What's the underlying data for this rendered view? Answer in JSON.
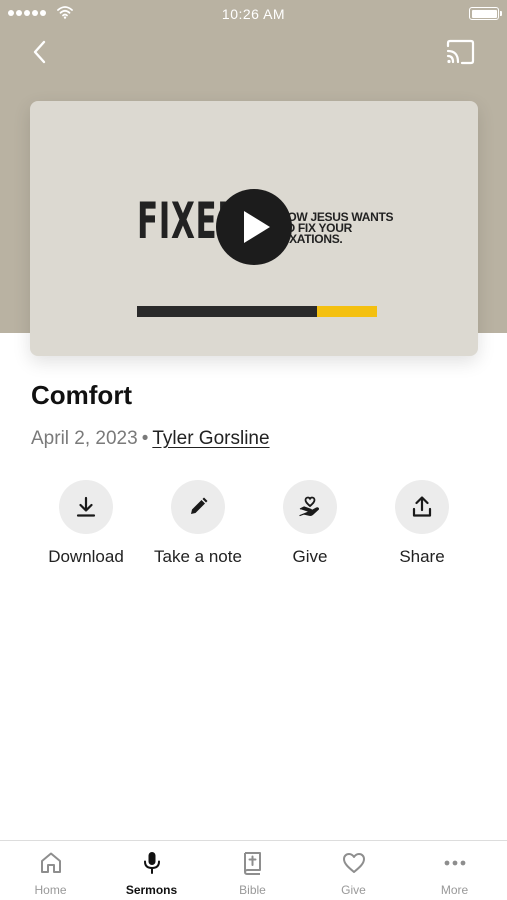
{
  "status_bar": {
    "time": "10:26 AM"
  },
  "video": {
    "series_title": "FIXED",
    "tagline": "HOW JESUS WANTS TO FIX YOUR FIXATIONS.",
    "progress": 0.25,
    "progress_color": "#f4c010"
  },
  "sermon": {
    "title": "Comfort",
    "date": "April 2, 2023",
    "separator": "•",
    "speaker": "Tyler Gorsline"
  },
  "actions": [
    {
      "label": "Download",
      "icon": "download-icon"
    },
    {
      "label": "Take a note",
      "icon": "pencil-icon"
    },
    {
      "label": "Give",
      "icon": "hand-heart-icon"
    },
    {
      "label": "Share",
      "icon": "share-icon"
    }
  ],
  "tabs": [
    {
      "label": "Home",
      "icon": "home-icon",
      "active": false
    },
    {
      "label": "Sermons",
      "icon": "microphone-icon",
      "active": true
    },
    {
      "label": "Bible",
      "icon": "bible-icon",
      "active": false
    },
    {
      "label": "Give",
      "icon": "heart-icon",
      "active": false
    },
    {
      "label": "More",
      "icon": "more-dots-icon",
      "active": false
    }
  ],
  "colors": {
    "hero_background": "#b9b2a2",
    "card_background": "#dcd9d1",
    "accent": "#f4c010",
    "active_tab": "#111111",
    "inactive_tab": "#999999"
  }
}
